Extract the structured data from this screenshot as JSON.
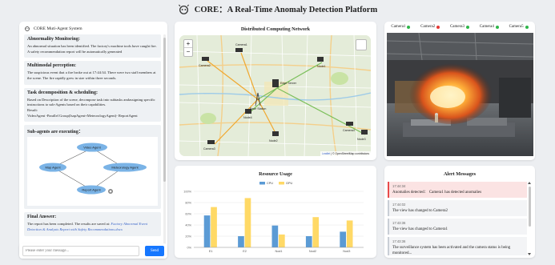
{
  "header": {
    "title": "CORE：A Real-Time Anomaly Detection Platform"
  },
  "left": {
    "system_name": "CORE Muti-Agent System",
    "messages": [
      {
        "heading": "Abnormality Monitoring:",
        "body": "An abnormal situation has been identified. The factory's machine tools have caught fire. A safety recommendation report will be automatically generated"
      },
      {
        "heading": "Multimodal perception:",
        "body": "The suspicious event that a fire broke out at 17:44:34. There were two staff members at the scene. The fire rapidly grew in size within three seconds."
      },
      {
        "heading": "Task decomposition & scheduling:",
        "body": "Based on Description of the scene, decompose task into subtasks andassigning specific instructions to sub-Agents based on their capabilities.",
        "result_label": "Result:",
        "result": "VideoAgent -Parallel Group(IsapAgent+MeteorologyAgent)- ReportAgent"
      },
      {
        "heading": "Sub-agents are executing：",
        "nodes": [
          "Video Agent",
          "Map Agent",
          "Meteorology Agent",
          "Report Agent"
        ]
      },
      {
        "heading": "Final Answer:",
        "body": "The report has been completed. The results are saved at:",
        "link": "Factory Abnormal Event Detection & Analysis Report with Safety Recommendations.docx"
      }
    ],
    "input_placeholder": "Please enter your message...",
    "send_label": "Send"
  },
  "network": {
    "title": "Distributed Computing Network",
    "zoom_in": "+",
    "zoom_out": "−",
    "nodes": [
      "Camera1",
      "Camera2",
      "Camera3",
      "Camera4",
      "Node1",
      "Node2",
      "Node3",
      "Node4",
      "Edge Server",
      "Base Station"
    ],
    "attribution_link": "Leaflet",
    "attribution_text": "| © OpenStreetMap contributors"
  },
  "resource": {
    "title": "Resource Usage"
  },
  "chart_data": {
    "type": "bar",
    "title": "Resource Usage",
    "categories": [
      "E1",
      "E2",
      "Nod1",
      "Nod2",
      "Nod3"
    ],
    "series": [
      {
        "name": "CPU",
        "color": "#5b9bd5",
        "values": [
          57,
          20,
          39,
          20,
          28
        ]
      },
      {
        "name": "GPU",
        "color": "#ffd966",
        "values": [
          72,
          88,
          23,
          54,
          48
        ]
      }
    ],
    "yticks": [
      "0%",
      "20%",
      "40%",
      "60%",
      "80%",
      "100%"
    ],
    "ylim": [
      0,
      100
    ],
    "legend": "top-center",
    "grid": true
  },
  "cameras": {
    "list": [
      {
        "name": "Camera1",
        "status": "#2fb54a"
      },
      {
        "name": "Camera2",
        "status": "#e53935"
      },
      {
        "name": "Camera3",
        "status": "#2fb54a"
      },
      {
        "name": "Camera4",
        "status": "#2fb54a"
      },
      {
        "name": "Camera5",
        "status": "#2fb54a"
      }
    ]
  },
  "alerts": {
    "title": "Alert Messages",
    "items": [
      {
        "time": "17:44:34",
        "text": "Anomalies detected： Camera1 has detected anomalies",
        "level": "danger"
      },
      {
        "time": "17:44:02",
        "text": "The view has changed to Camera2",
        "level": "info"
      },
      {
        "time": "17:43:36",
        "text": "The view has changed to Camera1",
        "level": "info"
      },
      {
        "time": "17:43:36",
        "text": "The surveillance system has been activated and the camera status is being monitored...",
        "level": "info"
      }
    ]
  }
}
